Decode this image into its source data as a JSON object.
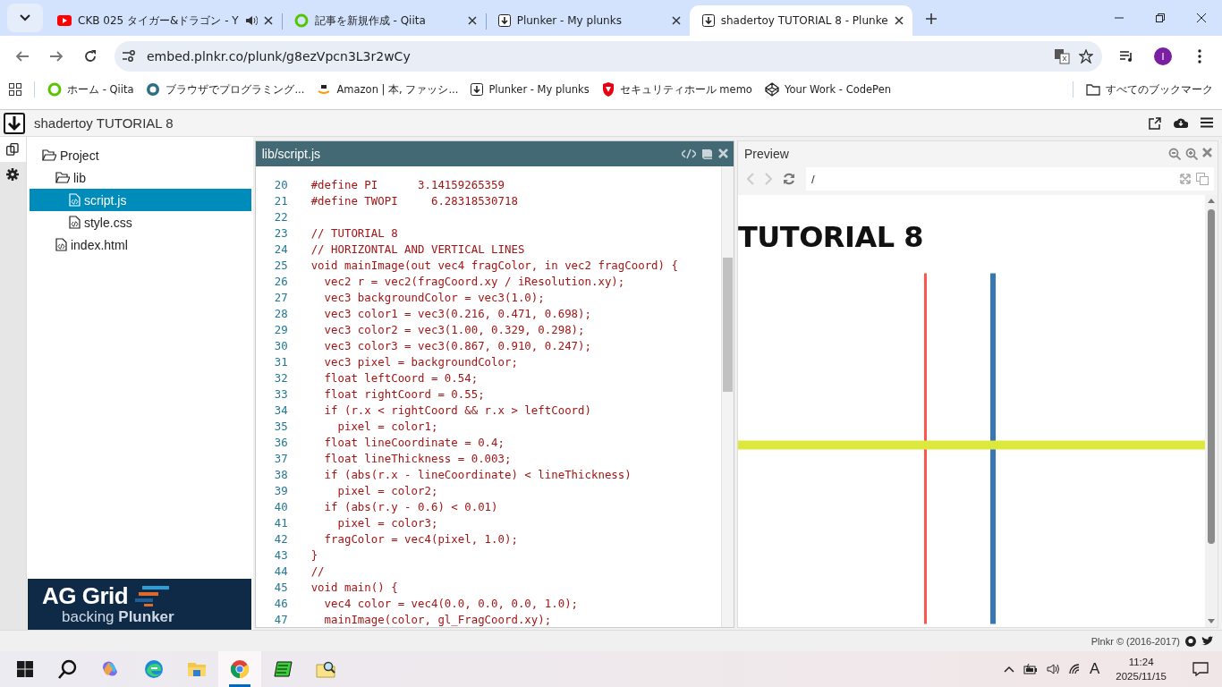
{
  "browser": {
    "tabs": [
      {
        "title": "CKB 025 タイガー&ドラゴン - Y",
        "kind": "video",
        "audio": true,
        "selected": false
      },
      {
        "title": "記事を新規作成 - Qiita",
        "kind": "qiita",
        "audio": false,
        "selected": false
      },
      {
        "title": "Plunker - My plunks",
        "kind": "plunker",
        "audio": false,
        "selected": false
      },
      {
        "title": "shadertoy TUTORIAL 8 - Plunke",
        "kind": "plunker",
        "audio": false,
        "selected": true
      }
    ],
    "address": "embed.plnkr.co/plunk/g8ezVpcn3L3r2wCy",
    "profile_initial": "I",
    "bookmarks": [
      {
        "label": "ホーム - Qiita",
        "kind": "qiita"
      },
      {
        "label": "ブラウザでプログラミング...",
        "kind": "circle"
      },
      {
        "label": "Amazon | 本, ファッシ...",
        "kind": "amazon"
      },
      {
        "label": "Plunker - My plunks",
        "kind": "plunker"
      },
      {
        "label": "セキュリティホール memo",
        "kind": "shield"
      },
      {
        "label": "Your Work - CodePen",
        "kind": "codepen"
      }
    ],
    "all_bookmarks": "すべてのブックマーク"
  },
  "plunker": {
    "title": "shadertoy TUTORIAL 8",
    "sidebar_tabs": [
      {
        "kind": "files",
        "selected": true
      },
      {
        "kind": "settings",
        "selected": false
      }
    ],
    "tree": [
      {
        "name": "Project",
        "kind": "folder",
        "selected": false,
        "children": [
          {
            "name": "lib",
            "kind": "folder",
            "selected": false,
            "children": [
              {
                "name": "script.js",
                "kind": "file",
                "selected": true
              },
              {
                "name": "style.css",
                "kind": "file",
                "selected": false
              }
            ]
          },
          {
            "name": "index.html",
            "kind": "file",
            "selected": false
          }
        ]
      }
    ],
    "ad": {
      "brand": "AG Grid",
      "tagline": "backing **Plunker**"
    },
    "editor": {
      "path": "lib/script.js",
      "lines": [
        {
          "number": "20",
          "code": "#define PI      3.14159265359"
        },
        {
          "number": "21",
          "code": "#define TWOPI     6.28318530718"
        },
        {
          "number": "22"
        },
        {
          "number": "23",
          "code": "// TUTORIAL 8"
        },
        {
          "number": "24",
          "code": "// HORIZONTAL AND VERTICAL LINES"
        },
        {
          "number": "25",
          "code": "void mainImage(out vec4 fragColor, in vec2 fragCoord) {"
        },
        {
          "number": "26",
          "code": "  vec2 r = vec2(fragCoord.xy / iResolution.xy);"
        },
        {
          "number": "27",
          "code": "  vec3 backgroundColor = vec3(1.0);"
        },
        {
          "number": "28",
          "code": "  vec3 color1 = vec3(0.216, 0.471, 0.698);"
        },
        {
          "number": "29",
          "code": "  vec3 color2 = vec3(1.00, 0.329, 0.298);"
        },
        {
          "number": "30",
          "code": "  vec3 color3 = vec3(0.867, 0.910, 0.247);"
        },
        {
          "number": "31",
          "code": "  vec3 pixel = backgroundColor;"
        },
        {
          "number": "32",
          "code": "  float leftCoord = 0.54;"
        },
        {
          "number": "33",
          "code": "  float rightCoord = 0.55;"
        },
        {
          "number": "34",
          "code": "  if (r.x < rightCoord && r.x > leftCoord)"
        },
        {
          "number": "35",
          "code": "    pixel = color1;"
        },
        {
          "number": "36",
          "code": "  float lineCoordinate = 0.4;"
        },
        {
          "number": "37",
          "code": "  float lineThickness = 0.003;"
        },
        {
          "number": "38",
          "code": "  if (abs(r.x - lineCoordinate) < lineThickness)"
        },
        {
          "number": "39",
          "code": "    pixel = color2;"
        },
        {
          "number": "40",
          "code": "  if (abs(r.y - 0.6) < 0.01)"
        },
        {
          "number": "41",
          "code": "    pixel = color3;"
        },
        {
          "number": "42",
          "code": "  fragColor = vec4(pixel, 1.0);"
        },
        {
          "number": "43",
          "code": "}"
        },
        {
          "number": "44",
          "code": "//"
        },
        {
          "number": "45",
          "code": "void main() {"
        },
        {
          "number": "46",
          "code": "  vec4 color = vec4(0.0, 0.0, 0.0, 1.0);"
        },
        {
          "number": "47",
          "code": "  mainImage(color, gl_FragCoord.xy);"
        }
      ]
    },
    "preview": {
      "title": "Preview",
      "url": "/",
      "heading": "TUTORIAL 8"
    },
    "footer": "Plnkr © (2016-2017)"
  },
  "taskbar": {
    "apps": [
      {
        "kind": "copilot",
        "selected": false
      },
      {
        "kind": "edge",
        "selected": false
      },
      {
        "kind": "explorer",
        "selected": false
      },
      {
        "kind": "chrome",
        "selected": true
      },
      {
        "kind": "notepad",
        "selected": false
      },
      {
        "kind": "finder",
        "selected": false
      }
    ],
    "ime": "A",
    "time": "11:24",
    "date": "2025/11/15"
  }
}
